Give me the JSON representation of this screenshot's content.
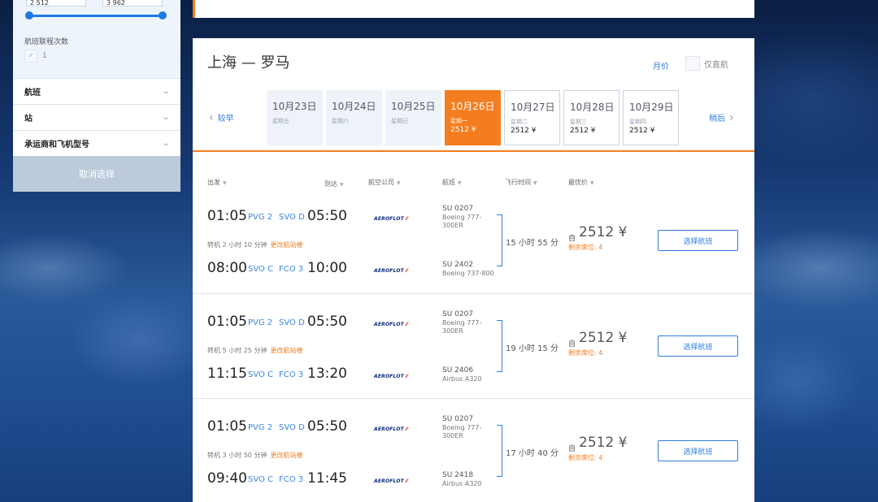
{
  "filter": {
    "price_min": "2 512",
    "price_max": "3 962",
    "stops_label": "航班联程次数",
    "stops_value": "1",
    "sections": [
      "航班",
      "站",
      "承运商和飞机型号"
    ],
    "clear_label": "取消选择"
  },
  "header": {
    "route": "上海 — 罗马",
    "monthly_label": "月价",
    "direct_only_label": "仅直航"
  },
  "date_nav": {
    "prev_label": "较早",
    "next_label": "稍后",
    "dates": [
      {
        "date": "10月23日",
        "weekday": "星期五",
        "price": ""
      },
      {
        "date": "10月24日",
        "weekday": "星期六",
        "price": ""
      },
      {
        "date": "10月25日",
        "weekday": "星期日",
        "price": ""
      },
      {
        "date": "10月26日",
        "weekday": "星期一",
        "price": "2512 ¥",
        "selected": true
      },
      {
        "date": "10月27日",
        "weekday": "星期二",
        "price": "2512 ¥"
      },
      {
        "date": "10月28日",
        "weekday": "星期三",
        "price": "2512 ¥"
      },
      {
        "date": "10月29日",
        "weekday": "星期四",
        "price": "2512 ¥"
      }
    ]
  },
  "columns": [
    "出发",
    "到达",
    "航空公司",
    "航班",
    "飞行时间",
    "最优价"
  ],
  "results": [
    {
      "leg1": {
        "dep": "01:05",
        "dep_code": "PVG 2",
        "arr_code": "SVO D",
        "arr": "05:50",
        "flight": "SU 0207",
        "aircraft": "Boeing 777-300ER"
      },
      "transfer": "转机 2 小时 10 分钟",
      "change_terminal": "更改航站楼",
      "leg2": {
        "dep": "08:00",
        "dep_code": "SVO C",
        "arr_code": "FCO 3",
        "arr": "10:00",
        "flight": "SU 2402",
        "aircraft": "Boeing 737-800"
      },
      "duration": "15 小时 55 分",
      "from_label": "自",
      "price": "2512 ¥",
      "seats": "剩余席位: 4",
      "button": "选择航班",
      "airline": "AEROFLOT"
    },
    {
      "leg1": {
        "dep": "01:05",
        "dep_code": "PVG 2",
        "arr_code": "SVO D",
        "arr": "05:50",
        "flight": "SU 0207",
        "aircraft": "Boeing 777-300ER"
      },
      "transfer": "转机 5 小时 25 分钟",
      "change_terminal": "更改航站楼",
      "leg2": {
        "dep": "11:15",
        "dep_code": "SVO C",
        "arr_code": "FCO 3",
        "arr": "13:20",
        "flight": "SU 2406",
        "aircraft": "Airbus A320"
      },
      "duration": "19 小时 15 分",
      "from_label": "自",
      "price": "2512 ¥",
      "seats": "剩余席位: 4",
      "button": "选择航班",
      "airline": "AEROFLOT"
    },
    {
      "leg1": {
        "dep": "01:05",
        "dep_code": "PVG 2",
        "arr_code": "SVO D",
        "arr": "05:50",
        "flight": "SU 0207",
        "aircraft": "Boeing 777-300ER"
      },
      "transfer": "转机 3 小时 50 分钟",
      "change_terminal": "更改航站楼",
      "leg2": {
        "dep": "09:40",
        "dep_code": "SVO C",
        "arr_code": "FCO 3",
        "arr": "11:45",
        "flight": "SU 2418",
        "aircraft": "Airbus A320"
      },
      "duration": "17 小时 40 分",
      "from_label": "自",
      "price": "2512 ¥",
      "seats": "剩余席位: 4",
      "button": "选择航班",
      "airline": "AEROFLOT"
    }
  ]
}
